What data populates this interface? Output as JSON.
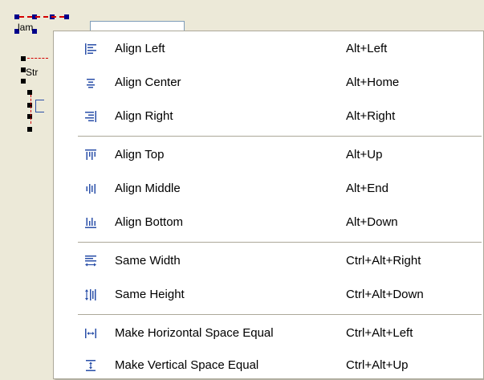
{
  "background": {
    "fragment_label_1": "lam",
    "fragment_label_2": "Str"
  },
  "menu": {
    "groups": [
      [
        {
          "label": "Align Left",
          "shortcut": "Alt+Left",
          "icon": "align-left-icon"
        },
        {
          "label": "Align Center",
          "shortcut": "Alt+Home",
          "icon": "align-center-icon"
        },
        {
          "label": "Align Right",
          "shortcut": "Alt+Right",
          "icon": "align-right-icon"
        }
      ],
      [
        {
          "label": "Align Top",
          "shortcut": "Alt+Up",
          "icon": "align-top-icon"
        },
        {
          "label": "Align Middle",
          "shortcut": "Alt+End",
          "icon": "align-middle-icon"
        },
        {
          "label": "Align Bottom",
          "shortcut": "Alt+Down",
          "icon": "align-bottom-icon"
        }
      ],
      [
        {
          "label": "Same Width",
          "shortcut": "Ctrl+Alt+Right",
          "icon": "same-width-icon"
        },
        {
          "label": "Same Height",
          "shortcut": "Ctrl+Alt+Down",
          "icon": "same-height-icon"
        }
      ],
      [
        {
          "label": "Make Horizontal Space Equal",
          "shortcut": "Ctrl+Alt+Left",
          "icon": "horizontal-space-equal-icon"
        },
        {
          "label": "Make Vertical Space Equal",
          "shortcut": "Ctrl+Alt+Up",
          "icon": "vertical-space-equal-icon"
        }
      ]
    ]
  },
  "colors": {
    "icon_blue": "#2a4fa8",
    "menu_border": "#aca899",
    "background": "#ece9d8"
  }
}
